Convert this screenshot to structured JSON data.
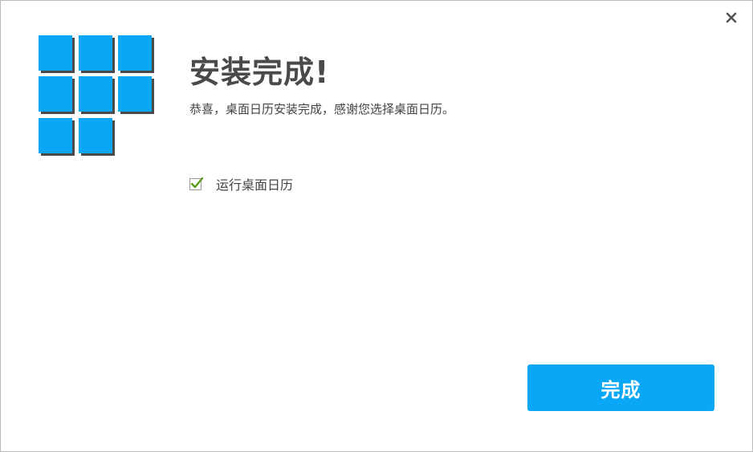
{
  "window": {
    "close_symbol": "×"
  },
  "logo": {
    "icon": "grid-tiles-logo",
    "color": "#0aa7f7"
  },
  "content": {
    "title": "安装完成!",
    "subtitle": "恭喜，桌面日历安装完成，感谢您选择桌面日历。"
  },
  "options": {
    "run_app": {
      "label": "运行桌面日历",
      "checked": true
    }
  },
  "actions": {
    "finish_label": "完成"
  },
  "colors": {
    "accent": "#0aa7f7",
    "check": "#5a9e1a"
  }
}
